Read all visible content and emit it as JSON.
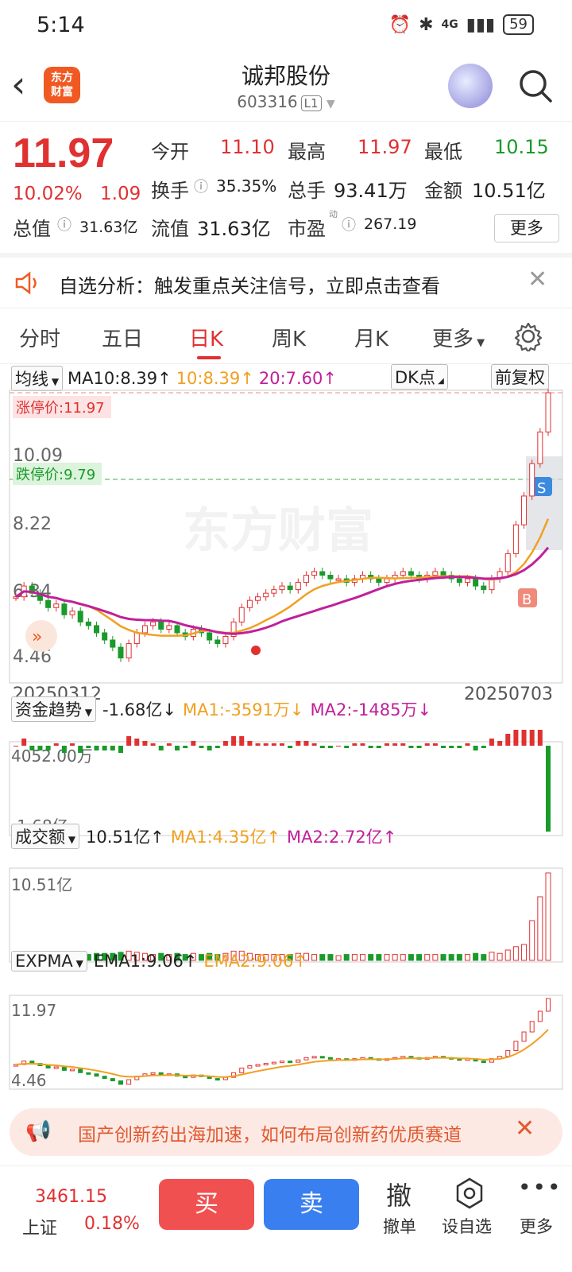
{
  "status": {
    "time": "5:14",
    "net": "4G",
    "battery": "59"
  },
  "header": {
    "stock_name": "诚邦股份",
    "stock_code": "603316",
    "code_badge": "L1",
    "logo_text": "东方财富"
  },
  "quote": {
    "price": "11.97",
    "pct": "10.02%",
    "change": "1.09",
    "open_label": "今开",
    "open": "11.10",
    "high_label": "最高",
    "high": "11.97",
    "low_label": "最低",
    "low": "10.15",
    "turnover_label": "换手",
    "turnover": "35.35%",
    "volume_label": "总手",
    "volume": "93.41万",
    "amount_label": "金额",
    "amount": "10.51亿",
    "mktcap_label": "总值",
    "mktcap": "31.63亿",
    "float_label": "流值",
    "float_cap": "31.63亿",
    "pe_label": "市盈",
    "pe_sup": "动",
    "pe": "267.19",
    "more_label": "更多"
  },
  "notice": {
    "text": "自选分析：触发重点关注信号，立即点击查看"
  },
  "tabs": [
    "分时",
    "五日",
    "日K",
    "周K",
    "月K",
    "更多"
  ],
  "active_tab": "日K",
  "kline": {
    "indicator": "均线",
    "ma_label": "MA10:8.39↑",
    "ma10": "10:8.39↑",
    "ma20": "20:7.60↑",
    "dk_label": "DK点",
    "adjust_label": "前复权",
    "limit_up_label": "涨停价:11.97",
    "limit_down_label": "跌停价:9.79",
    "y_labels": [
      "10.09",
      "8.22",
      "6.34",
      "4.46"
    ],
    "date_start": "20250312",
    "date_end": "20250703",
    "watermark": "东方财富"
  },
  "fund": {
    "name": "资金趋势",
    "value": "-1.68亿↓",
    "ma1": "MA1:-3591万↓",
    "ma2": "MA2:-1485万↓",
    "y_top": "4052.00万",
    "y_bottom": "-1.68亿"
  },
  "volume": {
    "name": "成交额",
    "value": "10.51亿↑",
    "ma1": "MA1:4.35亿↑",
    "ma2": "MA2:2.72亿↑",
    "y_top": "10.51亿"
  },
  "expma": {
    "name": "EXPMA",
    "ema1": "EMA1:9.06↑",
    "ema2": "EMA2:9.06↑",
    "y_top": "11.97",
    "y_bottom": "4.46"
  },
  "banner": {
    "text": "国产创新药出海加速，如何布局创新药优质赛道"
  },
  "bottom": {
    "index_name": "上证",
    "index_value": "3461.15",
    "index_pct": "0.18%",
    "buy": "买",
    "sell": "卖",
    "cancel_icon": "撤",
    "cancel": "撤单",
    "watch": "设自选",
    "more": "更多"
  },
  "colors": {
    "up": "#e03131",
    "down": "#1a9a2a",
    "ma10": "#f0a020",
    "ma20": "#c0209a",
    "accent": "#f05a22"
  },
  "chart_data": {
    "type": "candlestick",
    "x_range": [
      "20250312",
      "20250703"
    ],
    "ylim": [
      4.46,
      11.97
    ],
    "series": [
      {
        "name": "MA10",
        "last": 8.39
      },
      {
        "name": "20",
        "last": 7.6
      }
    ],
    "candles_close": [
      6.3,
      6.6,
      6.4,
      6.2,
      6.0,
      6.1,
      5.8,
      5.9,
      5.6,
      5.5,
      5.3,
      5.1,
      4.9,
      4.6,
      5.0,
      5.3,
      5.5,
      5.6,
      5.4,
      5.5,
      5.3,
      5.2,
      5.4,
      5.3,
      5.1,
      5.0,
      5.2,
      5.6,
      6.0,
      6.2,
      6.3,
      6.4,
      6.5,
      6.6,
      6.5,
      6.7,
      6.9,
      7.0,
      6.9,
      6.8,
      6.8,
      6.7,
      6.8,
      6.9,
      6.8,
      6.7,
      6.8,
      6.9,
      7.0,
      6.9,
      6.8,
      6.9,
      7.0,
      6.9,
      6.8,
      6.7,
      6.8,
      6.6,
      6.5,
      6.8,
      7.0,
      7.5,
      8.3,
      9.1,
      10.0,
      10.88,
      11.97
    ]
  }
}
